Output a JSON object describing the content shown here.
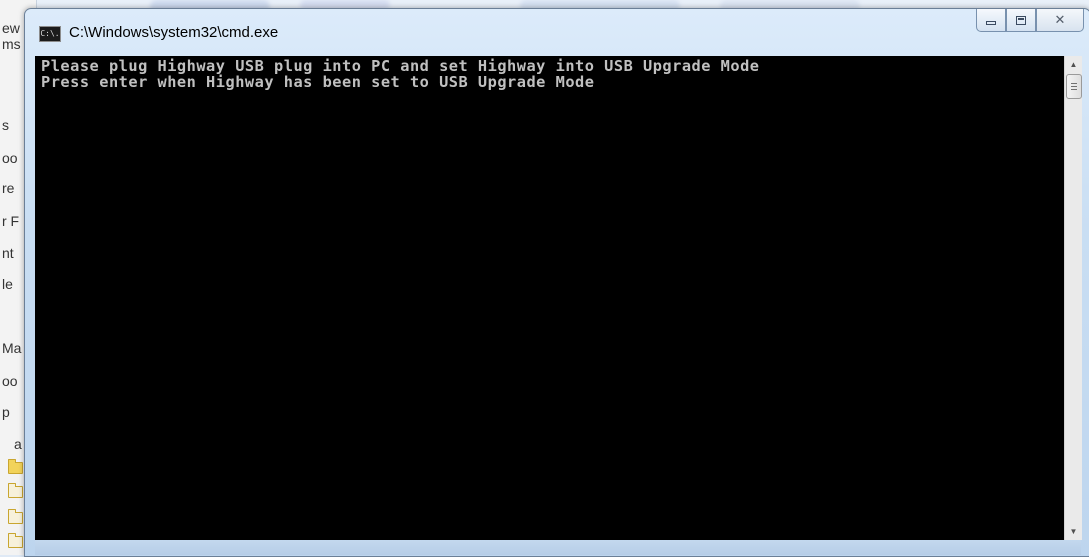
{
  "background": {
    "left_pane_items": [
      "ew",
      "ms",
      "s",
      "oo",
      "re",
      "r F",
      "nt",
      "le",
      "Ma",
      "oo",
      "p",
      "a"
    ]
  },
  "window": {
    "title": "C:\\Windows\\system32\\cmd.exe",
    "icon_text": "C:\\.",
    "buttons": {
      "minimize": "minimize",
      "maximize": "maximize",
      "close": "✕"
    }
  },
  "console": {
    "lines": [
      "Please plug Highway USB plug into PC and set Highway into USB Upgrade Mode",
      "Press enter when Highway has been set to USB Upgrade Mode"
    ],
    "colors": {
      "background": "#000000",
      "text": "#c0c0c0"
    }
  },
  "scrollbar": {
    "up_arrow": "▲",
    "down_arrow": "▼"
  }
}
